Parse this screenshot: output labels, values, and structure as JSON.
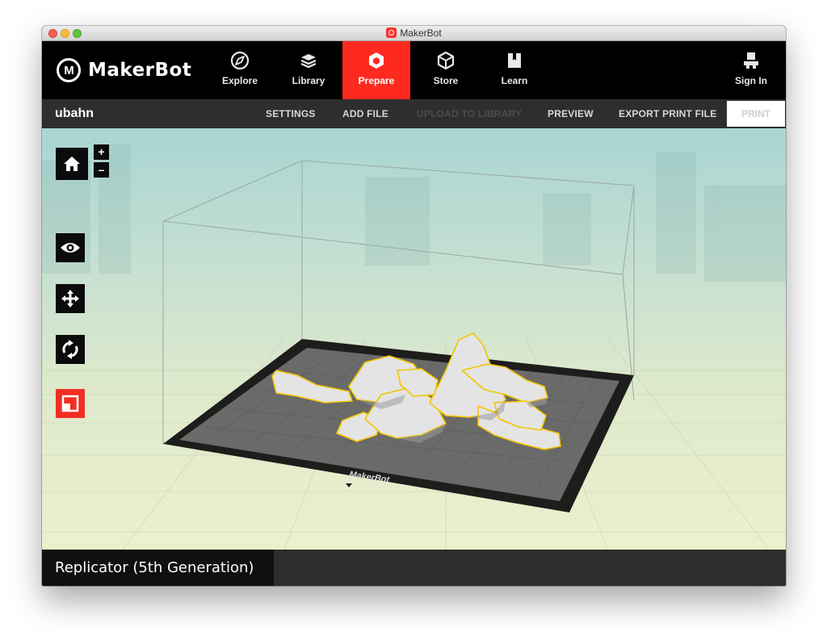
{
  "window": {
    "title": "MakerBot"
  },
  "nav": {
    "logo_text": "MakerBot",
    "logo_mark": "M",
    "items": [
      {
        "label": "Explore",
        "icon": "compass-icon",
        "active": false
      },
      {
        "label": "Library",
        "icon": "library-icon",
        "active": false
      },
      {
        "label": "Prepare",
        "icon": "prepare-icon",
        "active": true
      },
      {
        "label": "Store",
        "icon": "box-icon",
        "active": false
      },
      {
        "label": "Learn",
        "icon": "book-icon",
        "active": false
      }
    ],
    "sign_in": {
      "label": "Sign In",
      "icon": "user-icon"
    },
    "accent_color": "#ff2a1f"
  },
  "subbar": {
    "file_name": "ubahn",
    "settings": "SETTINGS",
    "add_file": "ADD FILE",
    "upload": "UPLOAD TO LIBRARY",
    "preview": "PREVIEW",
    "export": "EXPORT PRINT FILE",
    "print": "PRINT"
  },
  "viewport": {
    "zoom_in": "+",
    "zoom_out": "–",
    "tools": [
      "home-icon",
      "eye-icon",
      "move-icon",
      "rotate-icon",
      "scale-icon"
    ],
    "active_tool": "scale-icon",
    "plate_brand": "MakerBot"
  },
  "bottom": {
    "printer": "Replicator (5th Generation)"
  }
}
